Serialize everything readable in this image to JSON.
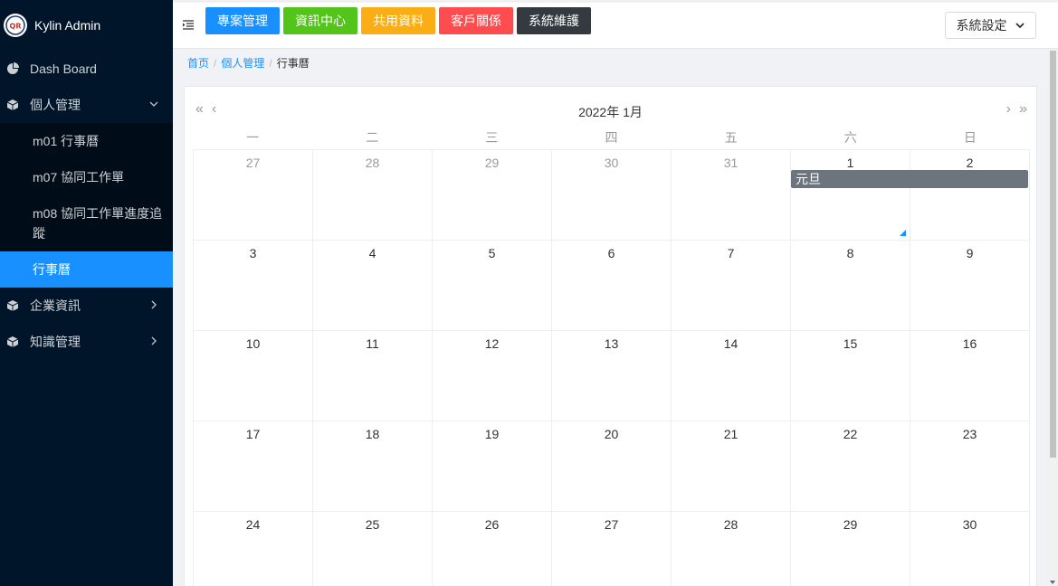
{
  "sidebar": {
    "brand": "Kylin Admin",
    "items": [
      {
        "label": "Dash Board",
        "icon": "pie-chart-icon"
      },
      {
        "label": "個人管理",
        "icon": "cube-icon",
        "expanded": true,
        "children": [
          {
            "label": "m01 行事曆"
          },
          {
            "label": "m07 協同工作單"
          },
          {
            "label": "m08 協同工作單進度追蹤"
          },
          {
            "label": "行事曆",
            "active": true
          }
        ]
      },
      {
        "label": "企業資訊",
        "icon": "cube-icon"
      },
      {
        "label": "知識管理",
        "icon": "cube-icon"
      }
    ]
  },
  "header": {
    "buttons": [
      {
        "label": "專案管理",
        "color": "#1890ff"
      },
      {
        "label": "資訊中心",
        "color": "#52c41a"
      },
      {
        "label": "共用資料",
        "color": "#faad14"
      },
      {
        "label": "客戶關係",
        "color": "#ff4d4f"
      },
      {
        "label": "系統維護",
        "color": "#343a40"
      }
    ],
    "settings_label": "系統設定"
  },
  "breadcrumb": {
    "home": "首页",
    "parent": "個人管理",
    "current": "行事曆"
  },
  "calendar": {
    "title": "2022年 1月",
    "nav": {
      "prev_year": "«",
      "prev_month": "‹",
      "next_month": "›",
      "next_year": "»"
    },
    "weekdays": [
      "一",
      "二",
      "三",
      "四",
      "五",
      "六",
      "日"
    ],
    "weeks": [
      [
        {
          "d": "27",
          "o": true
        },
        {
          "d": "28",
          "o": true
        },
        {
          "d": "29",
          "o": true
        },
        {
          "d": "30",
          "o": true
        },
        {
          "d": "31",
          "o": true
        },
        {
          "d": "1"
        },
        {
          "d": "2"
        }
      ],
      [
        {
          "d": "3"
        },
        {
          "d": "4"
        },
        {
          "d": "5"
        },
        {
          "d": "6"
        },
        {
          "d": "7"
        },
        {
          "d": "8"
        },
        {
          "d": "9"
        }
      ],
      [
        {
          "d": "10"
        },
        {
          "d": "11"
        },
        {
          "d": "12"
        },
        {
          "d": "13"
        },
        {
          "d": "14"
        },
        {
          "d": "15"
        },
        {
          "d": "16"
        }
      ],
      [
        {
          "d": "17"
        },
        {
          "d": "18"
        },
        {
          "d": "19"
        },
        {
          "d": "20"
        },
        {
          "d": "21"
        },
        {
          "d": "22"
        },
        {
          "d": "23"
        }
      ],
      [
        {
          "d": "24"
        },
        {
          "d": "25"
        },
        {
          "d": "26"
        },
        {
          "d": "27"
        },
        {
          "d": "28"
        },
        {
          "d": "29"
        },
        {
          "d": "30"
        }
      ]
    ],
    "event": {
      "label": "元旦",
      "color": "#6c757d"
    }
  }
}
